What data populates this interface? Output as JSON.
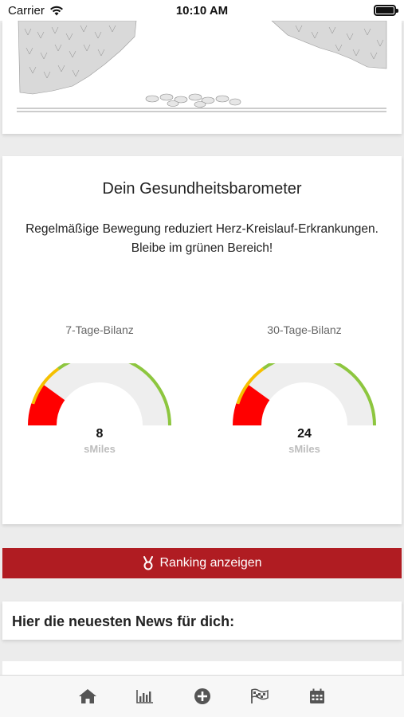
{
  "status_bar": {
    "carrier": "Carrier",
    "time": "10:10 AM"
  },
  "barometer": {
    "title": "Dein Gesundheitsbarometer",
    "subtitle": "Regelmäßige Bewegung reduziert Herz-Kreislauf-Erkrankungen. Bleibe im grünen Bereich!",
    "gauges": [
      {
        "label": "7-Tage-Bilanz",
        "value": "8",
        "unit": "sMiles",
        "fill_fraction": 0.2
      },
      {
        "label": "30-Tage-Bilanz",
        "value": "24",
        "unit": "sMiles",
        "fill_fraction": 0.2
      }
    ],
    "colors": {
      "red": "#ff0000",
      "yellow": "#f5c000",
      "green": "#8dc63f",
      "track": "#eeeeee"
    }
  },
  "ranking_button": {
    "label": "Ranking anzeigen",
    "icon": "medal-icon",
    "color": "#b01c22"
  },
  "news": {
    "title": "Hier die neuesten News für dich:"
  },
  "tabbar": {
    "items": [
      {
        "icon": "home-icon"
      },
      {
        "icon": "bar-chart-icon"
      },
      {
        "icon": "plus-circle-icon"
      },
      {
        "icon": "flags-icon"
      },
      {
        "icon": "calendar-icon"
      }
    ]
  }
}
